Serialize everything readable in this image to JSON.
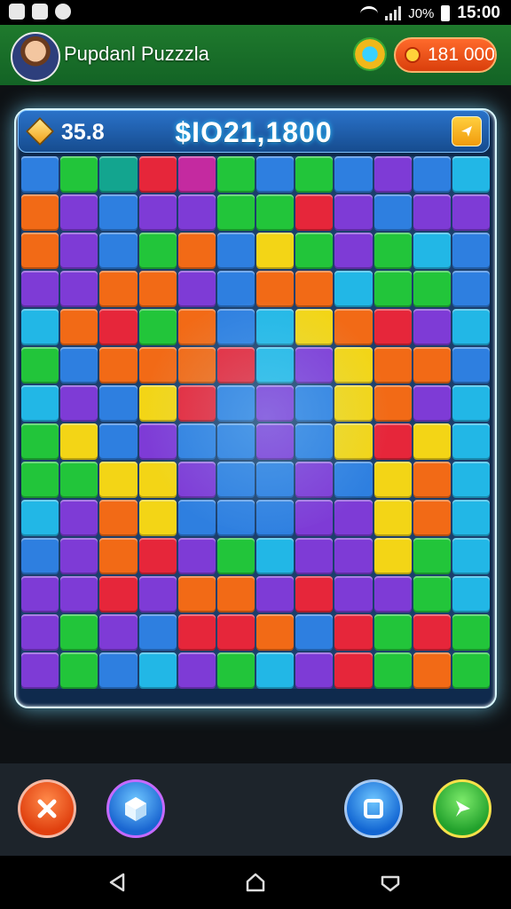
{
  "status_bar": {
    "battery_text": "J0%",
    "time": "15:00"
  },
  "header": {
    "title": "Pupdanl Puzzzla",
    "coins": "181 000"
  },
  "score_bar": {
    "gems": "35.8",
    "score": "$IO21,1800"
  },
  "colors": {
    "green": "#22c53a",
    "blue": "#2e7fe0",
    "purple": "#7e3bd6",
    "orange": "#f26a16",
    "yellow": "#f3d516",
    "red": "#e6263a",
    "cyan": "#22b7e6",
    "teal": "#13a58f",
    "magenta": "#c42aa0",
    "lime": "#68d82a"
  },
  "icons": {
    "gem": "diamond-icon",
    "hint": "hint-icon",
    "close": "close-icon",
    "cube": "cube-icon",
    "stop": "square-icon",
    "next": "next-arrow-icon"
  },
  "puzzle_grid": [
    [
      "blue",
      "green",
      "teal",
      "red",
      "magenta",
      "green",
      "blue",
      "green",
      "blue",
      "purple",
      "blue",
      "cyan"
    ],
    [
      "orange",
      "purple",
      "blue",
      "purple",
      "purple",
      "green",
      "green",
      "red",
      "purple",
      "blue",
      "purple",
      "purple"
    ],
    [
      "orange",
      "purple",
      "blue",
      "green",
      "orange",
      "blue",
      "yellow",
      "green",
      "purple",
      "green",
      "cyan",
      "blue"
    ],
    [
      "purple",
      "purple",
      "orange",
      "orange",
      "purple",
      "blue",
      "orange",
      "orange",
      "cyan",
      "green",
      "green",
      "blue"
    ],
    [
      "cyan",
      "orange",
      "red",
      "green",
      "orange",
      "blue",
      "cyan",
      "yellow",
      "orange",
      "red",
      "purple",
      "cyan"
    ],
    [
      "green",
      "blue",
      "orange",
      "orange",
      "orange",
      "red",
      "cyan",
      "purple",
      "yellow",
      "orange",
      "orange",
      "blue"
    ],
    [
      "cyan",
      "purple",
      "blue",
      "yellow",
      "red",
      "blue",
      "purple",
      "blue",
      "yellow",
      "orange",
      "purple",
      "cyan"
    ],
    [
      "green",
      "yellow",
      "blue",
      "purple",
      "blue",
      "blue",
      "purple",
      "blue",
      "yellow",
      "red",
      "yellow",
      "cyan"
    ],
    [
      "green",
      "green",
      "yellow",
      "yellow",
      "purple",
      "blue",
      "blue",
      "purple",
      "blue",
      "yellow",
      "orange",
      "cyan"
    ],
    [
      "cyan",
      "purple",
      "orange",
      "yellow",
      "blue",
      "blue",
      "blue",
      "purple",
      "purple",
      "yellow",
      "orange",
      "cyan"
    ],
    [
      "blue",
      "purple",
      "orange",
      "red",
      "purple",
      "green",
      "cyan",
      "purple",
      "purple",
      "yellow",
      "green",
      "cyan"
    ],
    [
      "purple",
      "purple",
      "red",
      "purple",
      "orange",
      "orange",
      "purple",
      "red",
      "purple",
      "purple",
      "green",
      "cyan"
    ],
    [
      "purple",
      "green",
      "purple",
      "blue",
      "red",
      "red",
      "orange",
      "blue",
      "red",
      "green",
      "red",
      "green"
    ],
    [
      "purple",
      "green",
      "blue",
      "cyan",
      "purple",
      "green",
      "cyan",
      "purple",
      "red",
      "green",
      "orange",
      "green"
    ]
  ]
}
